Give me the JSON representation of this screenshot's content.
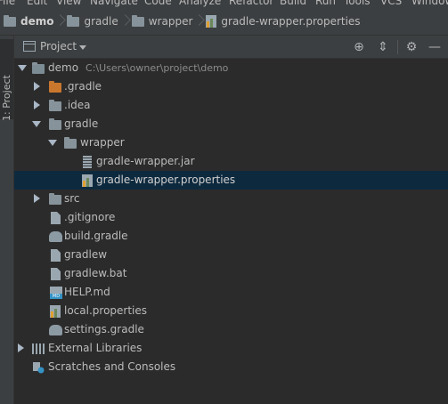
{
  "menu": [
    "File",
    "Edit",
    "View",
    "Navigate",
    "Code",
    "Analyze",
    "Refactor",
    "Build",
    "Run",
    "Tools",
    "VCS",
    "Window"
  ],
  "breadcrumb": [
    {
      "label": "demo",
      "icon": "folder-icon"
    },
    {
      "label": "gradle",
      "icon": "folder-icon"
    },
    {
      "label": "wrapper",
      "icon": "folder-icon"
    },
    {
      "label": "gradle-wrapper.properties",
      "icon": "properties-file-icon"
    }
  ],
  "toolwindow_tab": "1: Project",
  "panel": {
    "title": "Project",
    "actions": [
      "locate-icon",
      "collapse-all-icon",
      "gear-icon",
      "minimize-icon"
    ]
  },
  "tree": [
    {
      "label": "demo",
      "path": "C:\\Users\\owner\\project\\demo",
      "icon": "module-folder-icon",
      "expanded": true
    },
    {
      "label": ".gradle",
      "icon": "folder-icon",
      "expanded": false
    },
    {
      "label": ".idea",
      "icon": "folder-icon",
      "expanded": false
    },
    {
      "label": "gradle",
      "icon": "folder-icon",
      "expanded": true
    },
    {
      "label": "wrapper",
      "icon": "folder-icon",
      "expanded": true
    },
    {
      "label": "gradle-wrapper.jar",
      "icon": "jar-file-icon"
    },
    {
      "label": "gradle-wrapper.properties",
      "icon": "properties-file-icon",
      "selected": true
    },
    {
      "label": "src",
      "icon": "folder-icon",
      "expanded": false
    },
    {
      "label": ".gitignore",
      "icon": "text-file-icon"
    },
    {
      "label": "build.gradle",
      "icon": "gradle-file-icon"
    },
    {
      "label": "gradlew",
      "icon": "text-file-icon"
    },
    {
      "label": "gradlew.bat",
      "icon": "text-file-icon"
    },
    {
      "label": "HELP.md",
      "icon": "markdown-file-icon"
    },
    {
      "label": "local.properties",
      "icon": "properties-file-icon"
    },
    {
      "label": "settings.gradle",
      "icon": "gradle-file-icon"
    },
    {
      "label": "External Libraries",
      "icon": "libraries-icon",
      "expanded": false
    },
    {
      "label": "Scratches and Consoles",
      "icon": "scratches-icon"
    }
  ],
  "colors": {
    "background": "#2b2b2b",
    "panel": "#3c3f41",
    "selection": "#0d293e",
    "folder_orange": "#c9772d"
  }
}
